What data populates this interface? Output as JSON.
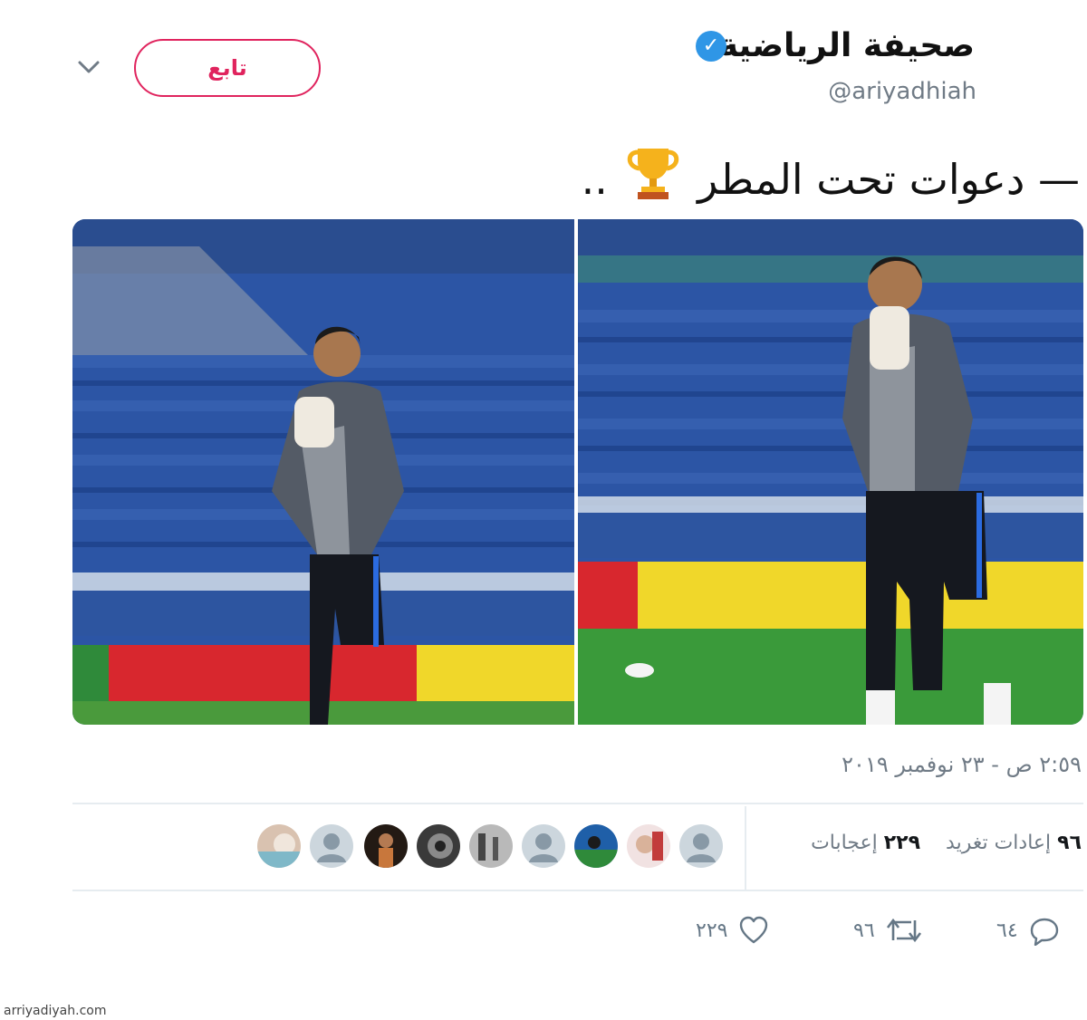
{
  "account": {
    "display_name": "صحيفة الرياضية",
    "verified_glyph": "✓",
    "handle": "@ariyadhiah"
  },
  "follow_button": {
    "label": "تابع"
  },
  "tweet": {
    "text": "— دعوات تحت المطر",
    "trailing": "..",
    "emoji": "trophy-icon"
  },
  "timestamp": "٢:٥٩ ص - ٢٣ نوفمبر ٢٠١٩",
  "stats": {
    "retweets_count": "٩٦",
    "retweets_label": "إعادات تغريد",
    "likes_count": "٢٢٩",
    "likes_label": "إعجابات"
  },
  "actions": {
    "replies": "٦٤",
    "retweets": "٩٦",
    "likes": "٢٢٩"
  },
  "footer": "arriyadiyah.com",
  "colors": {
    "accent": "#e0245e",
    "verified": "#2f96e6",
    "muted": "#707b86",
    "stadium_seats": "#2e57a8",
    "pitch": "#3a9a3a"
  }
}
